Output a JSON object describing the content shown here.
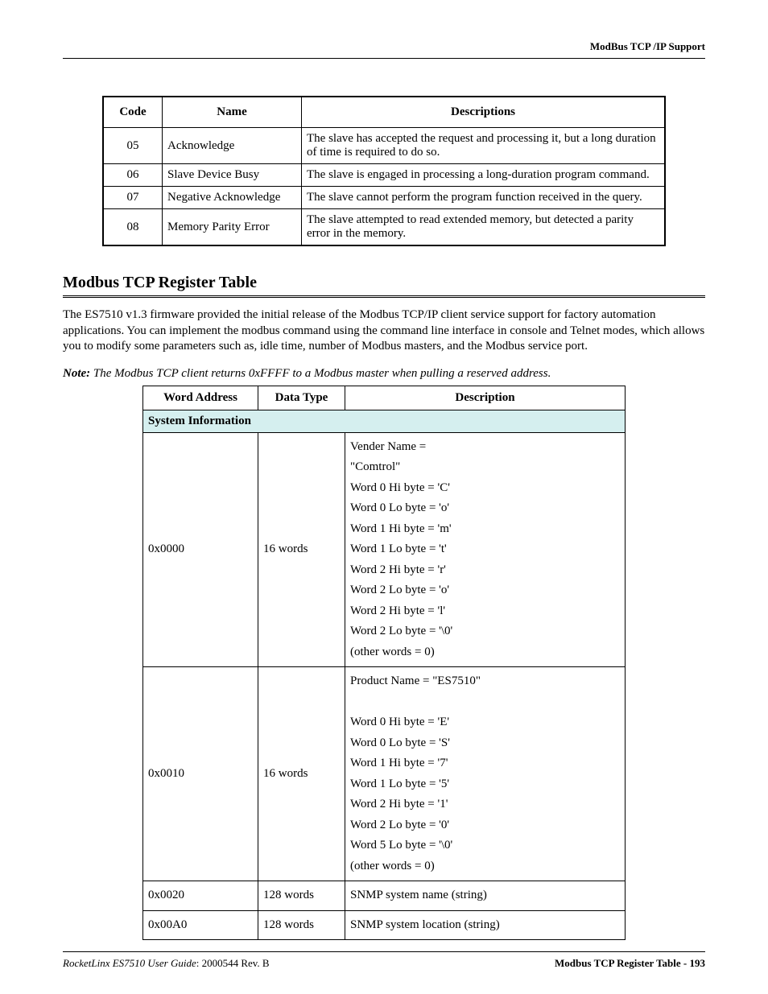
{
  "running_header": "ModBus TCP /IP Support",
  "error_table": {
    "headers": [
      "Code",
      "Name",
      "Descriptions"
    ],
    "rows": [
      {
        "code": "05",
        "name": "Acknowledge",
        "desc": "The slave has accepted the request and processing it, but a long duration of time is required to do so."
      },
      {
        "code": "06",
        "name": "Slave Device Busy",
        "desc": "The slave is engaged in processing a long-duration program command."
      },
      {
        "code": "07",
        "name": "Negative Acknowledge",
        "desc": "The slave cannot perform the program function received in the query."
      },
      {
        "code": "08",
        "name": "Memory Parity Error",
        "desc": "The slave attempted to read extended memory, but detected a parity error in the memory."
      }
    ]
  },
  "section_title": "Modbus TCP Register Table",
  "intro_para": "The ES7510 v1.3 firmware provided the initial release of the Modbus TCP/IP client service support for factory automation applications. You can implement the modbus command using the command line interface in console and Telnet modes, which allows you to modify some parameters such as, idle time, number of Modbus masters, and the Modbus service port.",
  "note": {
    "label": "Note:",
    "text": " The Modbus TCP client returns 0xFFFF to a Modbus master when pulling a reserved address."
  },
  "register_table": {
    "headers": [
      "Word Address",
      "Data Type",
      "Description"
    ],
    "section_label": "System Information",
    "rows": [
      {
        "addr": "0x0000",
        "type": "16 words",
        "desc_lines": [
          "Vender Name =",
          "\"Comtrol\"",
          "Word 0 Hi byte = 'C'",
          "Word 0 Lo byte = 'o'",
          "Word 1 Hi byte = 'm'",
          "Word 1 Lo byte = 't'",
          "Word 2 Hi byte = 'r'",
          "Word 2 Lo byte = 'o'",
          "Word 2 Hi byte = 'l'",
          "Word 2 Lo byte = '\\0'",
          "(other words = 0)"
        ]
      },
      {
        "addr": "0x0010",
        "type": "16 words",
        "desc_lines": [
          "Product Name = \"ES7510\"",
          "",
          "Word 0 Hi byte = 'E'",
          "Word 0 Lo byte = 'S'",
          "Word 1 Hi byte = '7'",
          "Word 1 Lo byte = '5'",
          "Word 2 Hi byte = '1'",
          "Word 2 Lo byte = '0'",
          "Word 5 Lo byte = '\\0'",
          "(other words = 0)"
        ]
      },
      {
        "addr": "0x0020",
        "type": "128 words",
        "desc_lines": [
          "SNMP system name (string)"
        ]
      },
      {
        "addr": "0x00A0",
        "type": "128 words",
        "desc_lines": [
          "SNMP system location (string)"
        ]
      }
    ]
  },
  "footer": {
    "left_product": "RocketLinx ES7510  User Guide",
    "left_rev": ": 2000544 Rev. B",
    "right": "Modbus TCP Register Table - 193"
  }
}
